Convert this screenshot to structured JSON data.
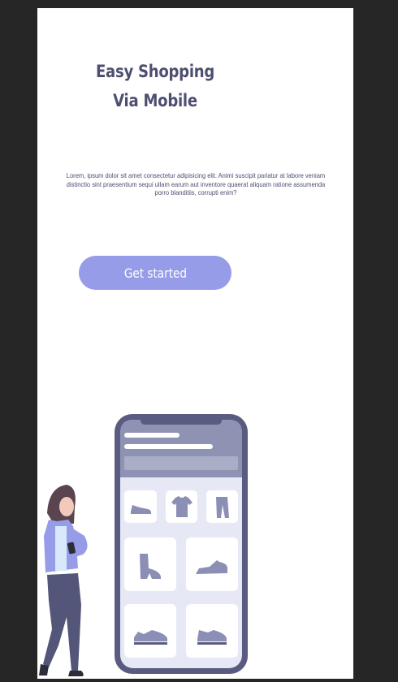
{
  "hero": {
    "title": "Easy Shopping Via Mobile",
    "description": "Lorem, ipsum dolor sit amet consectetur adipisicing elit. Animi suscipit pariatur at labore veniam distinctio sint praesentium sequi ullam earum aut inventore quaerat aliquam ratione assumenda porro blanditiis, corrupti enim?",
    "cta_label": "Get started"
  },
  "colors": {
    "accent": "#979ce8",
    "text": "#4d4f71",
    "phone_frame": "#5a5b80",
    "phone_screen": "#e6e8f5",
    "phone_header": "#8e93b3",
    "product_icon": "#8b8fb5"
  },
  "illustration": {
    "products": [
      "flat-shoe-icon",
      "tshirt-icon",
      "pants-icon",
      "boot-icon",
      "heel-shoe-icon",
      "sneaker-icon",
      "running-shoe-icon"
    ]
  }
}
